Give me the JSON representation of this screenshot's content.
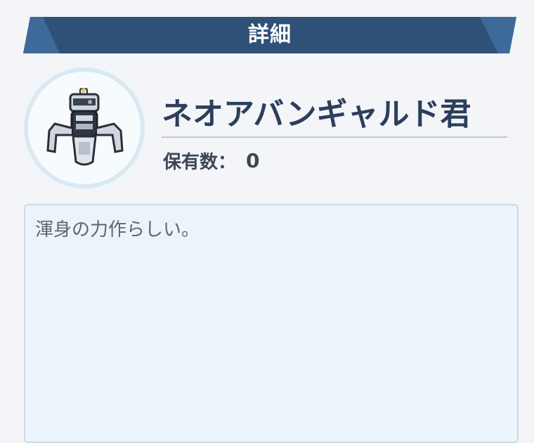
{
  "header": {
    "title": "詳細"
  },
  "item": {
    "icon": "spider-robot-icon",
    "name": "ネオアバンギャルド君",
    "owned_label": "保有数：",
    "owned_value": "0",
    "description": "渾身の力作らしい。"
  },
  "colors": {
    "header_bg": "#2f5177",
    "header_accent": "#3e6a99",
    "name_text": "#2b3f5c",
    "avatar_ring": "#d8e9f3",
    "desc_bg": "#ebf4fb"
  }
}
